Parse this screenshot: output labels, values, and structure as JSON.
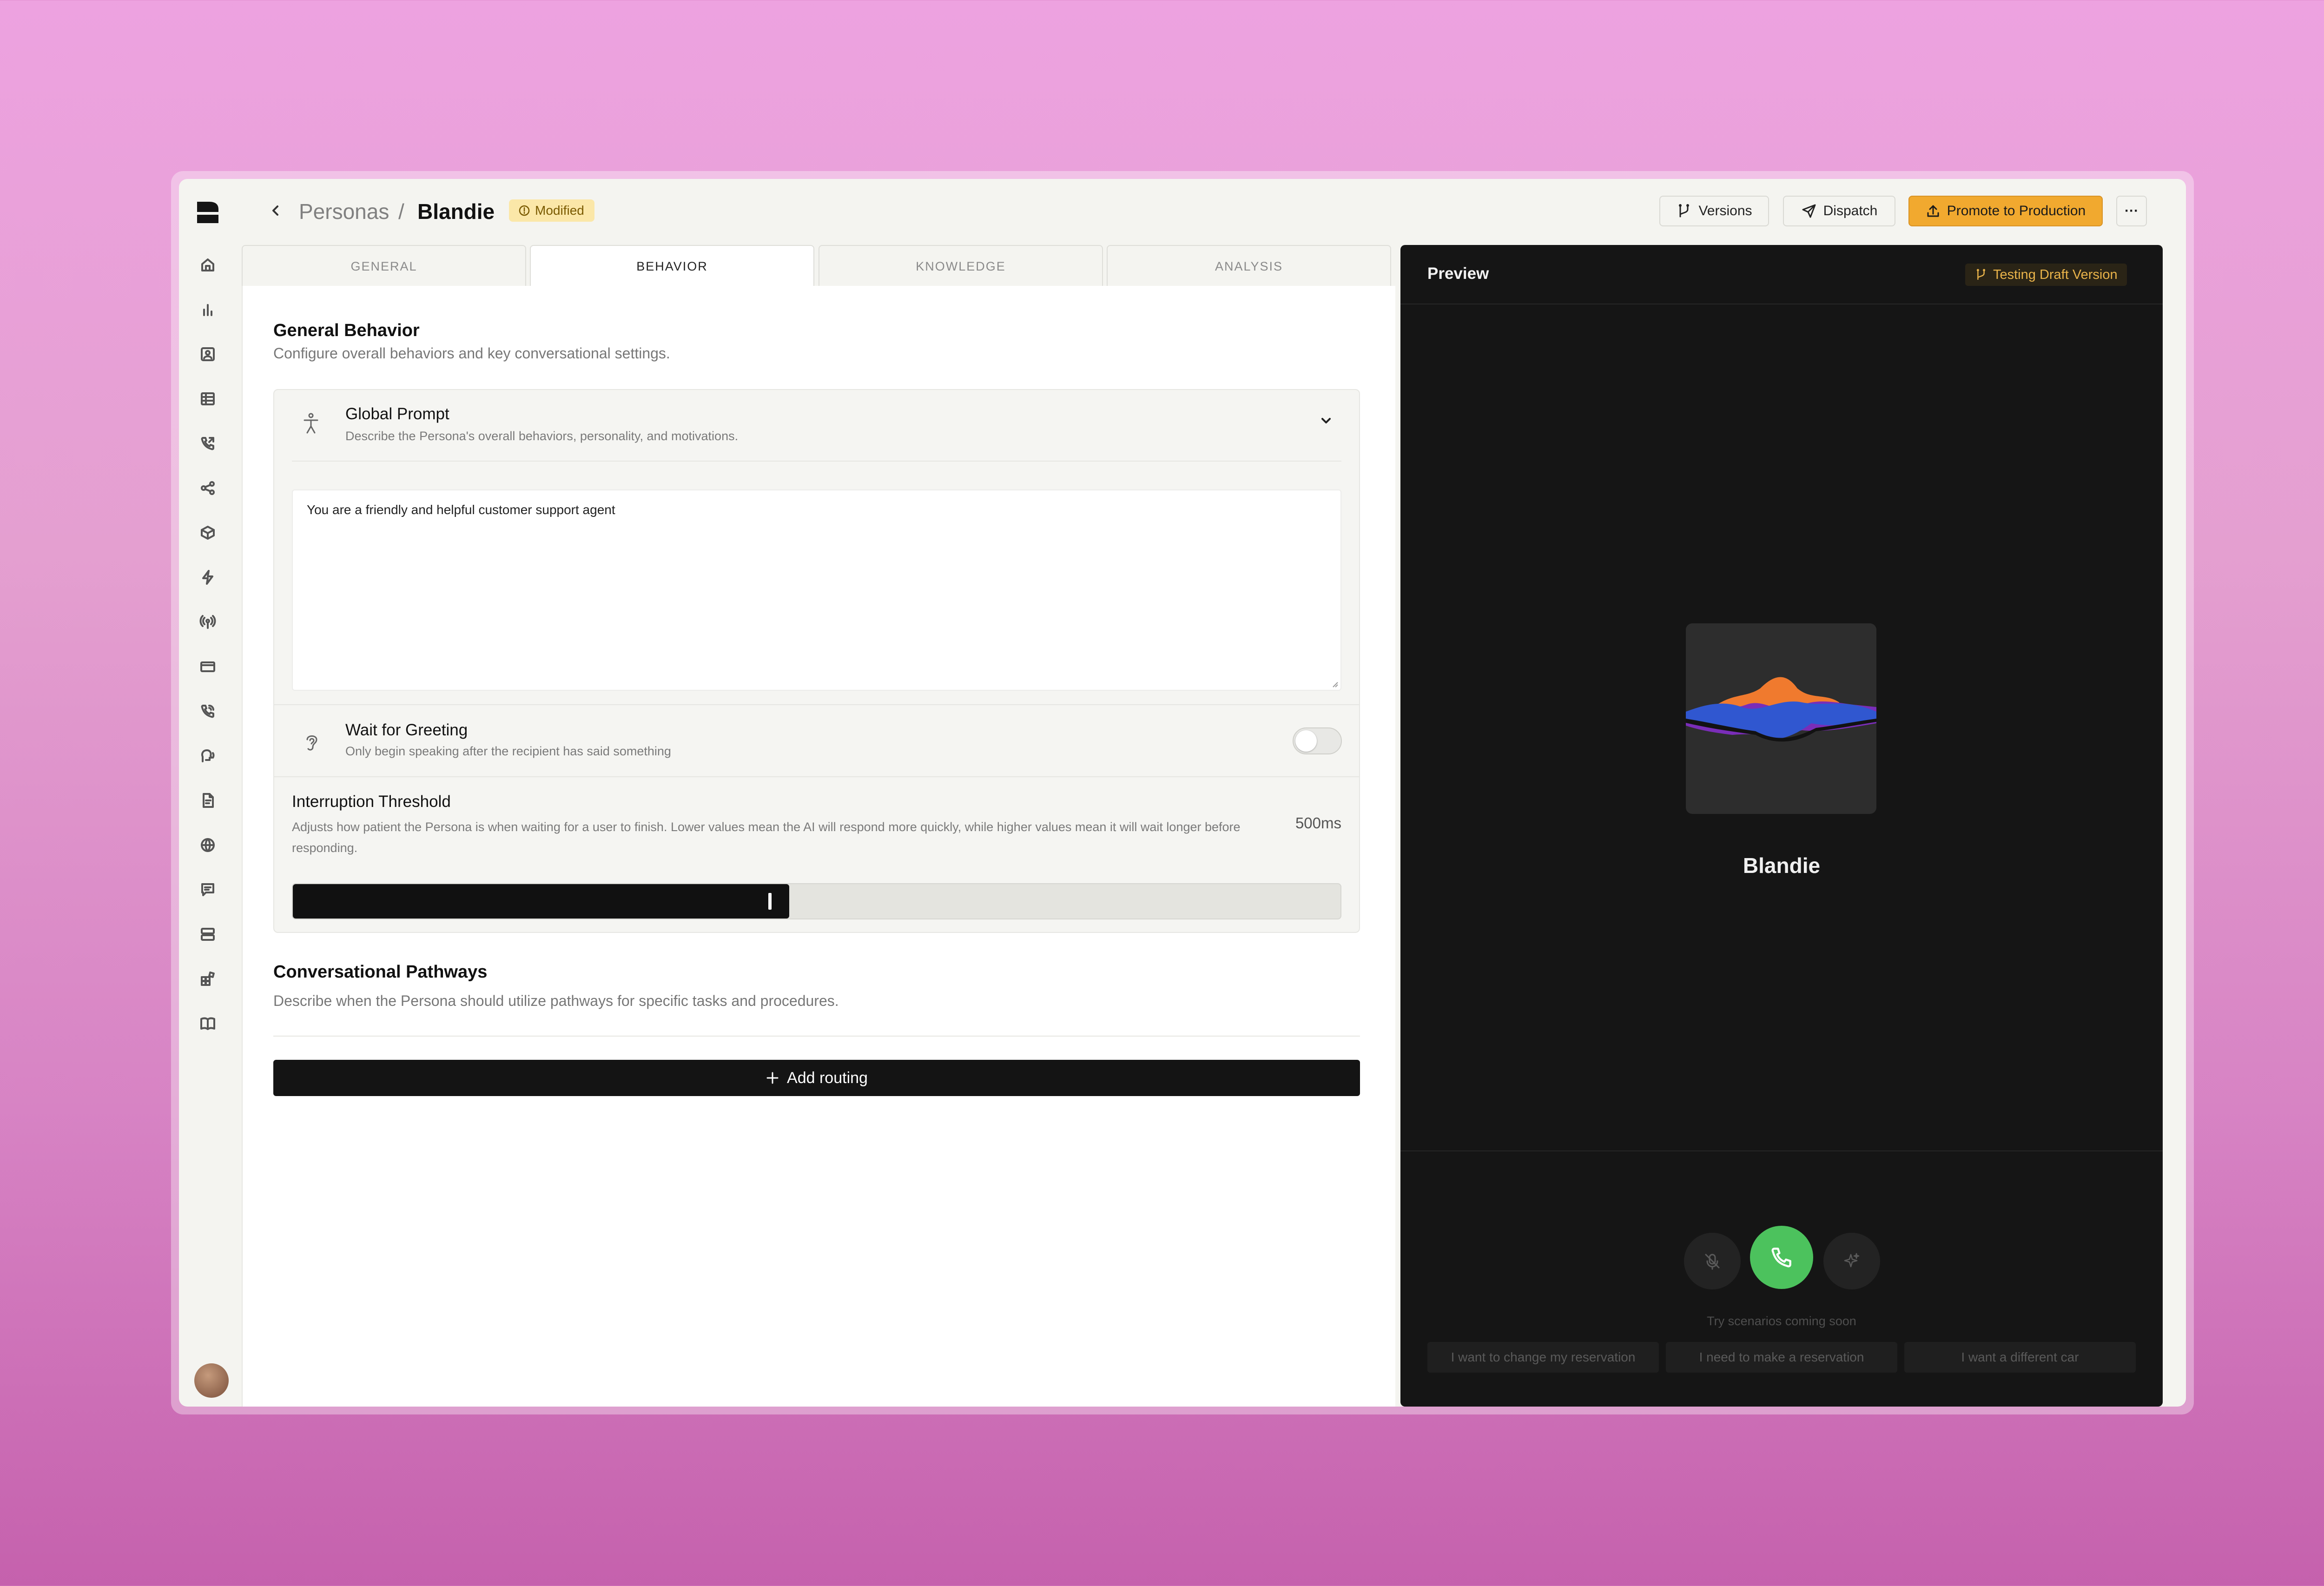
{
  "breadcrumb": {
    "parent": "Personas",
    "separator": "/",
    "current": "Blandie"
  },
  "status_badge": "Modified",
  "header_buttons": {
    "versions": "Versions",
    "dispatch": "Dispatch",
    "promote": "Promote to Production",
    "more": "···"
  },
  "tabs": [
    {
      "label": "GENERAL",
      "active": false
    },
    {
      "label": "BEHAVIOR",
      "active": true
    },
    {
      "label": "KNOWLEDGE",
      "active": false
    },
    {
      "label": "ANALYSIS",
      "active": false
    }
  ],
  "general_behavior": {
    "title": "General Behavior",
    "subtitle": "Configure overall behaviors and key conversational settings."
  },
  "global_prompt": {
    "title": "Global Prompt",
    "description": "Describe the Persona's overall behaviors, personality, and motivations.",
    "value": "You are a friendly and helpful customer support agent"
  },
  "wait_for_greeting": {
    "title": "Wait for Greeting",
    "description": "Only begin speaking after the recipient has said something",
    "enabled": false
  },
  "interruption_threshold": {
    "title": "Interruption Threshold",
    "description": "Adjusts how patient the Persona is when waiting for a user to finish. Lower values mean the AI will respond more quickly, while higher values mean it will wait longer before responding.",
    "value_label": "500ms",
    "fraction": 0.474
  },
  "pathways": {
    "title": "Conversational Pathways",
    "subtitle": "Describe when the Persona should utilize pathways for specific tasks and procedures.",
    "add_button": "Add routing"
  },
  "preview": {
    "title": "Preview",
    "badge": "Testing Draft Version",
    "persona_name": "Blandie",
    "scenarios_hint": "Try scenarios coming soon",
    "scenarios": [
      "I want to change my reservation",
      "I need to make a reservation",
      "I want a different car"
    ]
  },
  "colors": {
    "accent": "#f1a92f",
    "call_green": "#4cc25d",
    "badge_yellow": "#fbe7a8"
  },
  "sidebar_icons": [
    "home-icon",
    "chart-icon",
    "contact-icon",
    "table-icon",
    "phone-outgoing-icon",
    "share-icon",
    "package-icon",
    "bolt-icon",
    "broadcast-icon",
    "card-icon",
    "phone-call-icon",
    "voice-icon",
    "document-icon",
    "globe-icon",
    "message-icon",
    "server-icon",
    "integrations-icon",
    "book-icon"
  ]
}
